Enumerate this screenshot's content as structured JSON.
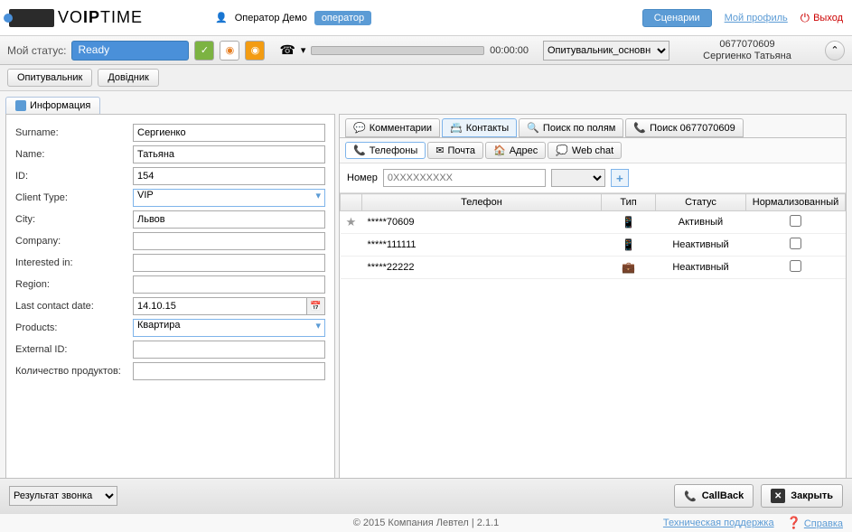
{
  "header": {
    "operator_label": "Оператор Демо",
    "operator_badge": "оператор",
    "scenarios_btn": "Сценарии",
    "profile_link": "Мой профиль",
    "logout": "Выход"
  },
  "statusbar": {
    "my_status_label": "Мой статус:",
    "status_value": "Ready",
    "timer": "00:00:00",
    "survey_value": "Опитувальник_основн",
    "customer_phone": "0677070609",
    "customer_name": "Сергиенко Татьяна"
  },
  "subnav": {
    "survey": "Опитувальник",
    "directory": "Довідник"
  },
  "info_tab": "Информация",
  "form": {
    "surname_label": "Surname:",
    "surname": "Сергиенко",
    "name_label": "Name:",
    "name": "Татьяна",
    "id_label": "ID:",
    "id": "154",
    "client_type_label": "Client Type:",
    "client_type": "VIP",
    "city_label": "City:",
    "city": "Львов",
    "company_label": "Company:",
    "company": "",
    "interested_label": "Interested in:",
    "interested": "",
    "region_label": "Region:",
    "region": "",
    "last_contact_label": "Last contact date:",
    "last_contact": "14.10.15",
    "products_label": "Products:",
    "products": "Квартира",
    "external_id_label": "External ID:",
    "external_id": "",
    "product_count_label": "Количество продуктов:",
    "product_count": ""
  },
  "right_tabs": {
    "comments": "Комментарии",
    "contacts": "Контакты",
    "field_search": "Поиск по полям",
    "phone_search": "Поиск 0677070609"
  },
  "contact_subtabs": {
    "phones": "Телефоны",
    "mail": "Почта",
    "address": "Адрес",
    "webchat": "Web chat"
  },
  "number_row": {
    "label": "Номер",
    "placeholder": "0XXXXXXXXX"
  },
  "phone_table": {
    "headers": {
      "phone": "Телефон",
      "type": "Тип",
      "status": "Статус",
      "normalized": "Нормализованный"
    },
    "rows": [
      {
        "star": true,
        "phone": "*****70609",
        "type": "mobile",
        "status": "Активный"
      },
      {
        "star": false,
        "phone": "*****111111",
        "type": "mobile",
        "status": "Неактивный"
      },
      {
        "star": false,
        "phone": "*****22222",
        "type": "work",
        "status": "Неактивный"
      }
    ]
  },
  "actionbar": {
    "result_label": "Результат звонка",
    "callback": "CallBack",
    "close": "Закрыть"
  },
  "copyright": {
    "text": "© 2015 Компания Левтел | 2.1.1",
    "support": "Техническая поддержка",
    "help": "Справка"
  }
}
